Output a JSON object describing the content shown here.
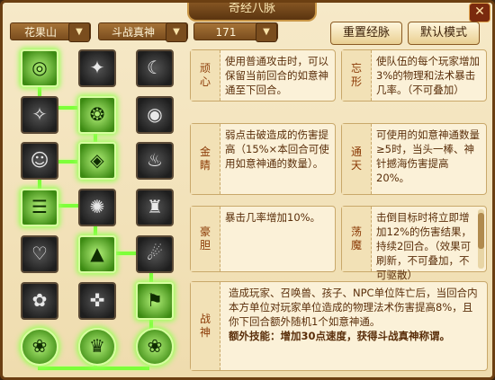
{
  "window": {
    "title": "奇经八脉",
    "close_glyph": "✕"
  },
  "toolbar": {
    "school": "花果山",
    "path": "斗战真神",
    "level": "171",
    "reset_label": "重置经脉",
    "default_label": "默认模式",
    "dropdown_glyph": "▼"
  },
  "tree": {
    "active_color": "#7dff3a",
    "nodes": [
      {
        "glyph": "◎",
        "on": true
      },
      {
        "glyph": "✦",
        "on": false
      },
      {
        "glyph": "☾",
        "on": false
      },
      {
        "glyph": "✧",
        "on": false
      },
      {
        "glyph": "❂",
        "on": true
      },
      {
        "glyph": "◉",
        "on": false
      },
      {
        "glyph": "☺",
        "on": false
      },
      {
        "glyph": "◈",
        "on": true
      },
      {
        "glyph": "♨",
        "on": false
      },
      {
        "glyph": "☰",
        "on": true
      },
      {
        "glyph": "✺",
        "on": false
      },
      {
        "glyph": "♜",
        "on": false
      },
      {
        "glyph": "♡",
        "on": false
      },
      {
        "glyph": "▲",
        "on": true
      },
      {
        "glyph": "☄",
        "on": false
      },
      {
        "glyph": "✿",
        "on": false
      },
      {
        "glyph": "✜",
        "on": false
      },
      {
        "glyph": "⚑",
        "on": true
      },
      {
        "glyph": "❀",
        "on": true
      },
      {
        "glyph": "♛",
        "on": true
      },
      {
        "glyph": "❀",
        "on": true
      }
    ]
  },
  "skills": [
    {
      "name": "顽心",
      "desc": "使用普通攻击时，可以保留当前回合的如意神通至下回合。"
    },
    {
      "name": "忘形",
      "desc": "使队伍的每个玩家增加3%的物理和法术暴击几率。（不可叠加）"
    },
    {
      "name": "金睛",
      "desc": "弱点击破造成的伤害提高（15%×本回合可使用如意神通的数量）。"
    },
    {
      "name": "通天",
      "desc": "可使用的如意神通数量≥5时，当头一棒、神针撼海伤害提高20%。"
    },
    {
      "name": "豪胆",
      "desc": "暴击几率增加10%。"
    },
    {
      "name": "荡魔",
      "desc": "击倒目标时将立即增加12%的伤害结果，持续2回合。（效果可刷新，不可叠加，不可驱散）"
    },
    {
      "name": "战神",
      "desc": "造成玩家、召唤兽、孩子、NPC单位阵亡后，当回合内本方单位对玩家单位造成的物理法术伤害提高8%，且你下回合额外随机1个如意神通。",
      "extra": "额外技能：增加30点速度，获得斗战真神称谓。"
    }
  ]
}
